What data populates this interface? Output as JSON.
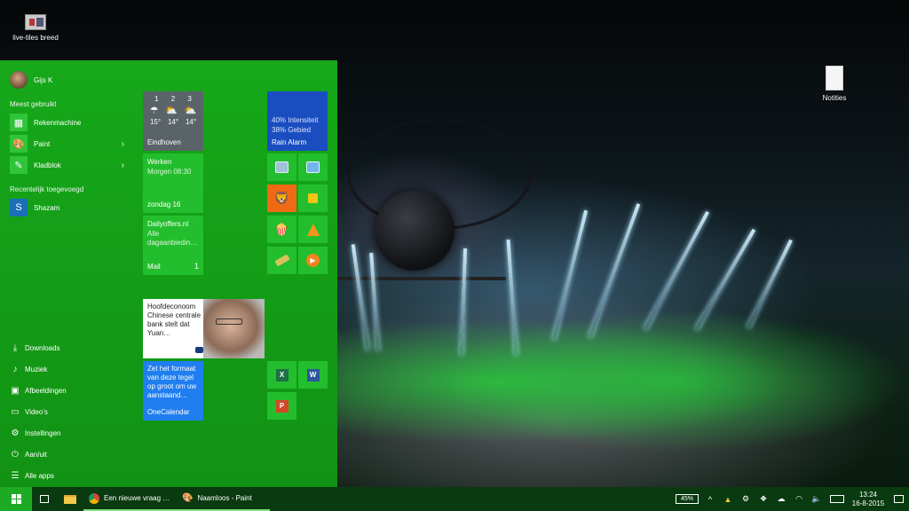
{
  "desktop": {
    "icons": [
      {
        "label": "live-tiles breed"
      },
      {
        "label": "Notities"
      }
    ]
  },
  "start_menu": {
    "user_name": "Gijs K",
    "most_used_heading": "Meest gebruikt",
    "most_used": [
      {
        "label": "Rekenmachine",
        "icon": "calculator-icon",
        "has_submenu": false
      },
      {
        "label": "Paint",
        "icon": "paint-icon",
        "has_submenu": true
      },
      {
        "label": "Kladblok",
        "icon": "notepad-icon",
        "has_submenu": true
      }
    ],
    "recent_heading": "Recentelijk toegevoegd",
    "recent": [
      {
        "label": "Shazam",
        "icon": "shazam-icon"
      }
    ],
    "bottom_links": [
      {
        "label": "Downloads",
        "icon": "download-icon"
      },
      {
        "label": "Muziek",
        "icon": "music-icon"
      },
      {
        "label": "Afbeeldingen",
        "icon": "image-icon"
      },
      {
        "label": "Video's",
        "icon": "video-icon"
      },
      {
        "label": "Instellingen",
        "icon": "gear-icon"
      },
      {
        "label": "Aan/uit",
        "icon": "power-icon"
      },
      {
        "label": "Alle apps",
        "icon": "list-icon"
      }
    ],
    "tiles": {
      "weather": {
        "days": [
          "1",
          "2",
          "3"
        ],
        "temps": [
          "15°",
          "14°",
          "14°"
        ],
        "location": "Eindhoven"
      },
      "rain_alarm": {
        "line1": "40% Intensiteit",
        "line2": "38% Gebied",
        "label": "Rain Alarm"
      },
      "calendar": {
        "title": "Werken",
        "subtitle": "Morgen 08:30",
        "label": "zondag 16"
      },
      "mail": {
        "line1": "Dailyoffers.nl",
        "line2": "Alle",
        "line3": "dagaanbiedin…",
        "label": "Mail",
        "count": "1"
      },
      "news": {
        "text": "Hoofdeconoom Chinese centrale bank stelt dat Yuan…"
      },
      "onecalendar": {
        "text": "Zet het formaat van deze tegel op groot om uw aanstaand…",
        "label": "OneCalendar"
      }
    }
  },
  "taskbar": {
    "apps": [
      {
        "label": "Een nieuwe vraag …",
        "icon": "chrome-icon"
      },
      {
        "label": "Naamloos - Paint",
        "icon": "paint-icon"
      }
    ],
    "battery": "45%",
    "time": "13:24",
    "date": "16-8-2015"
  },
  "colors": {
    "start_menu_bg": "#16a81a",
    "tile_green": "#23be2d",
    "tile_blue": "#1f7ef0",
    "tile_rain": "#1a4ec0",
    "tile_weather": "#5a6468",
    "taskbar_bg": "#0a3a10"
  }
}
